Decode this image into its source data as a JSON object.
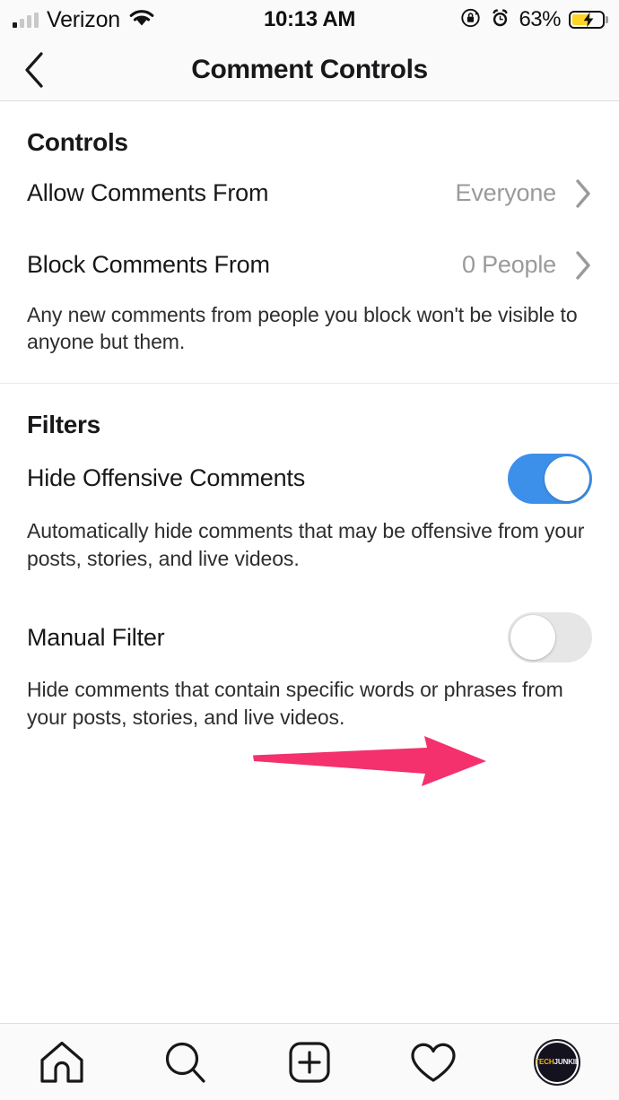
{
  "status_bar": {
    "carrier": "Verizon",
    "time": "10:13 AM",
    "battery_percent": "63%",
    "battery_level": 63,
    "icons": {
      "signal": "signal-bars-icon",
      "wifi": "wifi-icon",
      "rotation_lock": "rotation-lock-icon",
      "alarm": "alarm-clock-icon",
      "battery": "battery-charging-icon"
    }
  },
  "header": {
    "title": "Comment Controls",
    "back_icon": "chevron-left-icon"
  },
  "sections": [
    {
      "title": "Controls",
      "rows": [
        {
          "label": "Allow Comments From",
          "value": "Everyone",
          "accessory": "chevron-right-icon"
        },
        {
          "label": "Block Comments From",
          "value": "0 People",
          "accessory": "chevron-right-icon"
        }
      ],
      "description": "Any new comments from people you block won't be visible to anyone but them."
    },
    {
      "title": "Filters",
      "toggles": [
        {
          "label": "Hide Offensive Comments",
          "state": "on",
          "description": "Automatically hide comments that may be offensive from your posts, stories, and live videos."
        },
        {
          "label": "Manual Filter",
          "state": "off",
          "description": "Hide comments that contain specific words or phrases from your posts, stories, and live videos."
        }
      ]
    }
  ],
  "annotation": {
    "type": "arrow",
    "points_to": "manual-filter-toggle",
    "color": "#f4306d"
  },
  "tab_bar": {
    "items": [
      {
        "name": "home-icon",
        "label": "Home"
      },
      {
        "name": "search-icon",
        "label": "Search"
      },
      {
        "name": "add-post-icon",
        "label": "Add Post"
      },
      {
        "name": "activity-heart-icon",
        "label": "Activity"
      },
      {
        "name": "profile-avatar",
        "label": "Profile"
      }
    ],
    "avatar_text_part1": "TECH",
    "avatar_text_part2": "JUNKIE"
  },
  "colors": {
    "toggle_on": "#3d90ea",
    "toggle_off": "#e6e6e6",
    "arrow": "#f4306d",
    "value_text": "#9a9a9a",
    "battery": "#ffd426"
  }
}
